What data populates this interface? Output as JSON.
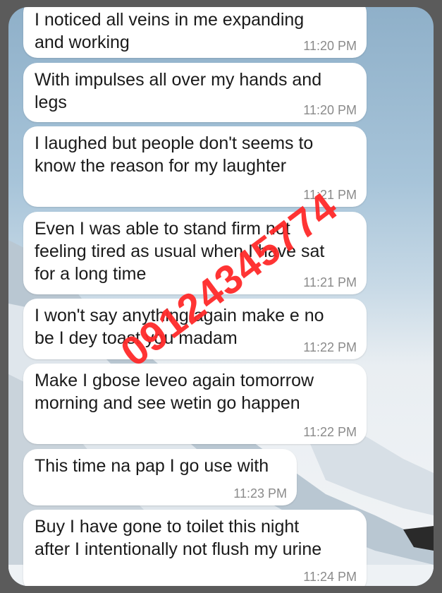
{
  "messages": [
    {
      "text": "I noticed all veins in me expanding\nand working",
      "time": "11:20 PM"
    },
    {
      "text": "With impulses all over my hands and\nlegs",
      "time": "11:20 PM"
    },
    {
      "text": "I laughed but people don't seems to\nknow the reason for my laughter",
      "time": "11:21 PM"
    },
    {
      "text": "Even I was able to stand firm not\nfeeling tired as usual when I have sat\nfor a long time",
      "time": "11:21 PM"
    },
    {
      "text": "I won't say anything again make e no\nbe I dey toast you madam",
      "time": "11:22 PM"
    },
    {
      "text": "Make I gbose leveo again tomorrow\nmorning and see wetin go happen",
      "time": "11:22 PM"
    },
    {
      "text": "This time na pap I go use with",
      "time": "11:23 PM"
    },
    {
      "text": "Buy I have gone to toilet this night\nafter I intentionally not flush my urine",
      "time": "11:24 PM"
    }
  ],
  "watermark": "09124345774",
  "colors": {
    "bubble": "#ffffff",
    "watermark": "#ff2a2a",
    "timestamp": "#8a8a8a"
  }
}
